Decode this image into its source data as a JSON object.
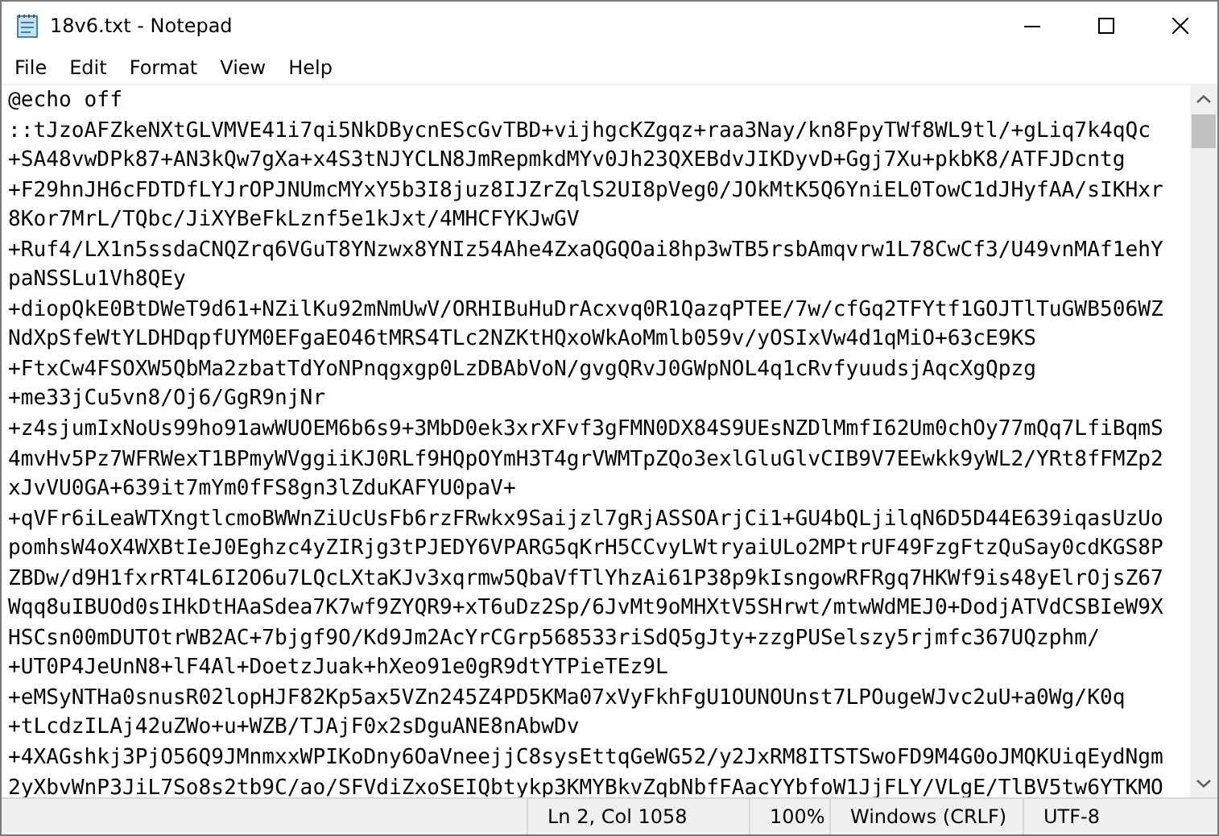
{
  "window": {
    "title": "18v6.txt - Notepad"
  },
  "menu": [
    "File",
    "Edit",
    "Format",
    "View",
    "Help"
  ],
  "editor": {
    "lines": [
      "@echo off",
      "::tJzoAFZkeNXtGLVMVE41i7qi5NkDBycnEScGvTBD+vijhgcKZgqz+raa3Nay/kn8FpyTWf8WL9tl/+gLiq7k4qQc",
      "+SA48vwDPk87+AN3kQw7gXa+x4S3tNJYCLN8JmRepmkdMYv0Jh23QXEBdvJIKDyvD+Ggj7Xu+pkbK8/ATFJDcntg",
      "+F29hnJH6cFDTDfLYJrOPJNUmcMYxY5b3I8juz8IJZrZqlS2UI8pVeg0/JOkMtK5Q6YniEL0TowC1dJHyfAA/sIKHxr",
      "8Kor7MrL/TQbc/JiXYBeFkLznf5e1kJxt/4MHCFYKJwGV",
      "+Ruf4/LX1n5ssdaCNQZrq6VGuT8YNzwx8YNIz54Ahe4ZxaQGQOai8hp3wTB5rsbAmqvrw1L78CwCf3/U49vnMAf1ehY",
      "paNSSLu1Vh8QEy",
      "+diopQkE0BtDWeT9d61+NZilKu92mNmUwV/ORHIBuHuDrAcxvq0R1QazqPTEE/7w/cfGq2TFYtf1GOJTlTuGWB506WZ",
      "NdXpSfeWtYLDHDqpfUYM0EFgaEO46tMRS4TLc2NZKtHQxoWkAoMmlb059v/yOSIxVw4d1qMiO+63cE9KS",
      "+FtxCw4FSOXW5QbMa2zbatTdYoNPnqgxgp0LzDBAbVoN/gvgQRvJ0GWpNOL4q1cRvfyuudsjAqcXgQpzg",
      "+me33jCu5vn8/Oj6/GgR9njNr",
      "+z4sjumIxNoUs99ho91awWUOEM6b6s9+3MbD0ek3xrXFvf3gFMN0DX84S9UEsNZDlMmfI62Um0chOy77mQq7LfiBqmS",
      "4mvHv5Pz7WFRWexT1BPmyWVggiiKJ0RLf9HQpOYmH3T4grVWMTpZQo3exlGluGlvCIB9V7EEwkk9yWL2/YRt8fFMZp2",
      "xJvVU0GA+639it7mYm0fFS8gn3lZduKAFYU0paV+",
      "+qVFr6iLeaWTXngtlcmoBWWnZiUcUsFb6rzFRwkx9Saijzl7gRjASSOArjCi1+GU4bQLjilqN6D5D44E639iqasUzUo",
      "pomhsW4oX4WXBtIeJ0Eghzc4yZIRjg3tPJEDY6VPARG5qKrH5CCvyLWtryaiULo2MPtrUF49FzgFtzQuSay0cdKGS8P",
      "ZBDw/d9H1fxrRT4L6I2O6u7LQcLXtaKJv3xqrmw5QbaVfTlYhzAi61P38p9kIsngowRFRgq7HKWf9is48yElrOjsZ67",
      "Wqq8uIBUOd0sIHkDtHAaSdea7K7wf9ZYQR9+xT6uDz2Sp/6JvMt9oMHXtV5SHrwt/mtwWdMEJ0+DodjATVdCSBIeW9X",
      "HSCsn00mDUTOtrWB2AC+7bjgf9O/Kd9Jm2AcYrCGrp568533riSdQ5gJty+zzgPUSelszy5rjmfc367UQzphm/",
      "+UT0P4JeUnN8+lF4Al+DoetzJuak+hXeo91e0gR9dtYTPieTEz9L",
      "+eMSyNTHa0snusR02lopHJF82Kp5ax5VZn245Z4PD5KMa07xVyFkhFgU1OUNOUnst7LPOugeWJvc2uU+a0Wg/K0q",
      "+tLcdzILAj42uZWo+u+WZB/TJAjF0x2sDguANE8nAbwDv",
      "+4XAGshkj3PjO56Q9JMnmxxWPIKoDny6OaVneejjC8sysEttqGeWG52/y2JxRM8ITSTSwoFD9M4G0oJMQKUiqEydNgm",
      "2yXbvWnP3JiL7So8s2tb9C/ao/SFVdiZxoSEIQbtykp3KMYBkvZqbNbfFAacYYbfoW1JjFLY/VLgE/TlBV5tw6YTKMO"
    ]
  },
  "status_bar": [
    "Ln 2, Col 1058",
    "100%",
    "Windows (CRLF)",
    "UTF-8"
  ]
}
